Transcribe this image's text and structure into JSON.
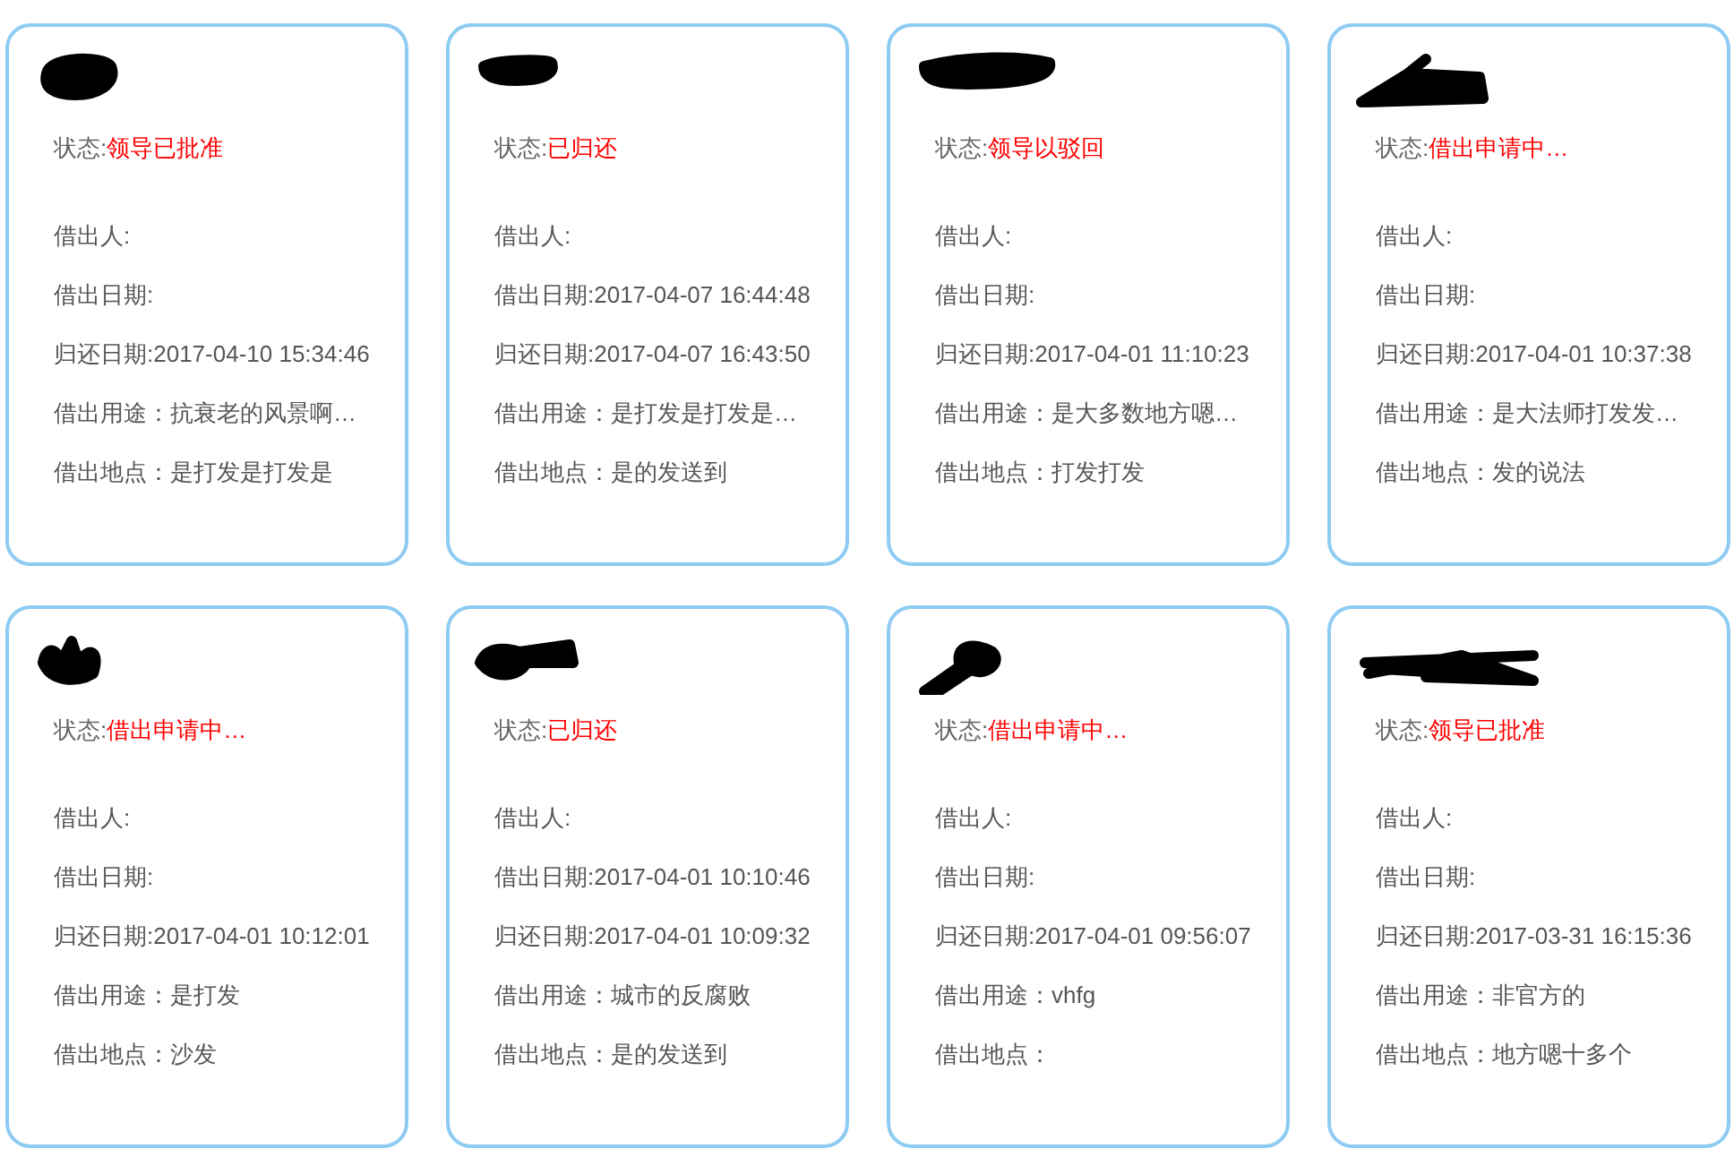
{
  "cards": [
    {
      "status": {
        "label": "状态:",
        "value": "领导已批准"
      },
      "fields": [
        "借出人:",
        "借出日期:",
        "归还日期:2017-04-10 15:34:46",
        "借出用途：抗衰老的风景啊…",
        "借出地点：是打发是打发是"
      ]
    },
    {
      "status": {
        "label": "状态:",
        "value": "已归还"
      },
      "fields": [
        "借出人:",
        "借出日期:2017-04-07 16:44:48",
        "归还日期:2017-04-07 16:43:50",
        "借出用途：是打发是打发是…",
        "借出地点：是的发送到"
      ]
    },
    {
      "status": {
        "label": "状态:",
        "value": "领导以驳回"
      },
      "fields": [
        "借出人:",
        "借出日期:",
        "归还日期:2017-04-01 11:10:23",
        "借出用途：是大多数地方嗯…",
        "借出地点：打发打发"
      ]
    },
    {
      "status": {
        "label": "状态:",
        "value": "借出申请中…"
      },
      "fields": [
        "借出人:",
        "借出日期:",
        "归还日期:2017-04-01 10:37:38",
        "借出用途：是大法师打发发…",
        "借出地点：发的说法"
      ]
    },
    {
      "status": {
        "label": "状态:",
        "value": "借出申请中…"
      },
      "fields": [
        "借出人:",
        "借出日期:",
        "归还日期:2017-04-01 10:12:01",
        "借出用途：是打发",
        "借出地点：沙发"
      ]
    },
    {
      "status": {
        "label": "状态:",
        "value": "已归还"
      },
      "fields": [
        "借出人:",
        "借出日期:2017-04-01 10:10:46",
        "归还日期:2017-04-01 10:09:32",
        "借出用途：城市的反腐败",
        "借出地点：是的发送到"
      ]
    },
    {
      "status": {
        "label": "状态:",
        "value": "借出申请中…"
      },
      "fields": [
        "借出人:",
        "借出日期:",
        "归还日期:2017-04-01 09:56:07",
        "借出用途：vhfg",
        "借出地点："
      ]
    },
    {
      "status": {
        "label": "状态:",
        "value": "领导已批准"
      },
      "fields": [
        "借出人:",
        "借出日期:",
        "归还日期:2017-03-31 16:15:36",
        "借出用途：非官方的",
        "借出地点：地方嗯十多个"
      ]
    }
  ]
}
